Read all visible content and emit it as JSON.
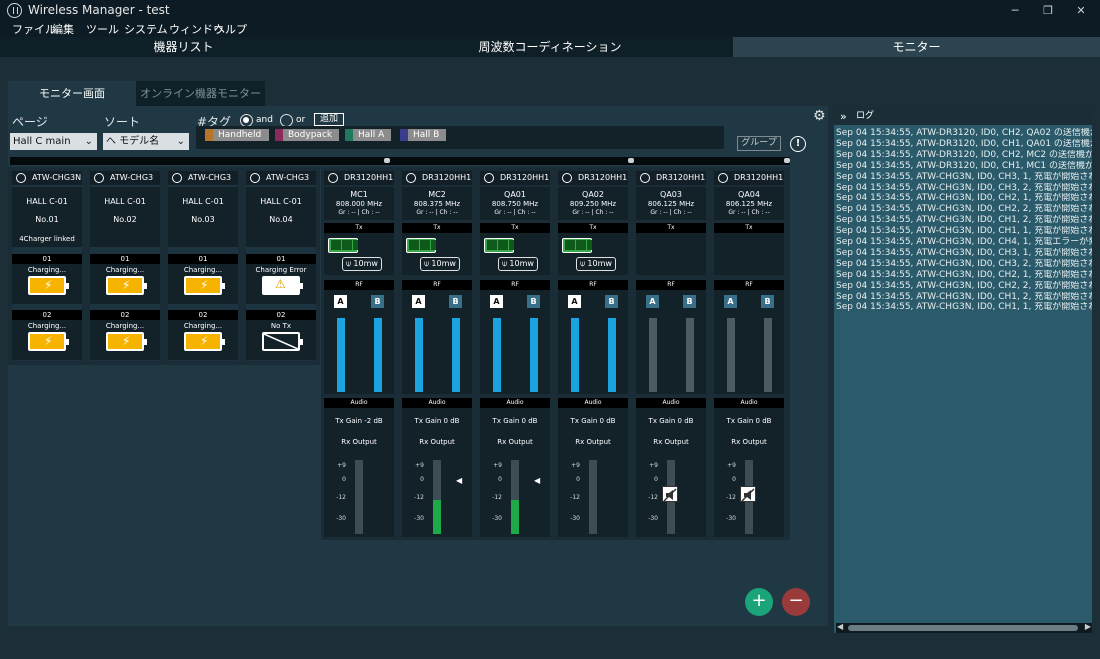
{
  "window": {
    "title": "Wireless Manager - test",
    "controls": [
      "─",
      "❐",
      "✕"
    ]
  },
  "menu": [
    "ファイル",
    "編集",
    "ツール",
    "システム",
    "ウィンドウ",
    "ヘルプ"
  ],
  "main_tabs": [
    {
      "label": "機器リスト"
    },
    {
      "label": "周波数コーディネーション"
    },
    {
      "label": "モニター"
    }
  ],
  "sub_tabs": [
    {
      "label": "モニター画面"
    },
    {
      "label": "オンライン機器モニター"
    }
  ],
  "filters": {
    "page_label": "ページ",
    "page_value": "Hall C main",
    "sort_label": "ソート",
    "sort_value": "へ モデル名",
    "tag_label": "#タグ",
    "and_label": "and",
    "or_label": "or",
    "add_label": "追加",
    "group_label": "グループ",
    "exclaim": "!"
  },
  "tags": [
    {
      "name": "Handheld",
      "color": "#b5752a"
    },
    {
      "name": "Bodypack",
      "color": "#8c2a5a"
    },
    {
      "name": "Hall A",
      "color": "#1e7a5a"
    },
    {
      "name": "Hall B",
      "color": "#3a3c8c"
    }
  ],
  "chargers": [
    {
      "model": "ATW-CHG3N",
      "room": "HALL C-01",
      "no": "No.01",
      "extra": "4Charger linked",
      "slots": [
        {
          "num": "01",
          "status": "Charging...",
          "state": "charging"
        },
        {
          "num": "02",
          "status": "Charging...",
          "state": "charging"
        }
      ]
    },
    {
      "model": "ATW-CHG3",
      "room": "HALL C-01",
      "no": "No.02",
      "extra": "",
      "slots": [
        {
          "num": "01",
          "status": "Charging...",
          "state": "charging"
        },
        {
          "num": "02",
          "status": "Charging...",
          "state": "charging"
        }
      ]
    },
    {
      "model": "ATW-CHG3",
      "room": "HALL C-01",
      "no": "No.03",
      "extra": "",
      "slots": [
        {
          "num": "01",
          "status": "Charging...",
          "state": "charging"
        },
        {
          "num": "02",
          "status": "Charging...",
          "state": "charging"
        }
      ]
    },
    {
      "model": "ATW-CHG3",
      "room": "HALL C-01",
      "no": "No.04",
      "extra": "",
      "slots": [
        {
          "num": "01",
          "status": "Charging Error",
          "state": "error"
        },
        {
          "num": "02",
          "status": "No Tx",
          "state": "none"
        }
      ]
    }
  ],
  "receivers": [
    {
      "model": "DR3120HH1",
      "name": "MC1",
      "freq": "808.000 MHz",
      "grch": "Gr : -- | Ch : --",
      "tx": true,
      "power": "10mw",
      "rf_active": true,
      "gain": "Tx Gain  -2  dB",
      "level": "none",
      "mute": false
    },
    {
      "model": "DR3120HH1",
      "name": "MC2",
      "freq": "808.375 MHz",
      "grch": "Gr : -- | Ch : --",
      "tx": true,
      "power": "10mw",
      "rf_active": true,
      "gain": "Tx Gain   0  dB",
      "level": "green",
      "mute": false
    },
    {
      "model": "DR3120HH1",
      "name": "QA01",
      "freq": "808.750 MHz",
      "grch": "Gr : -- | Ch : --",
      "tx": true,
      "power": "10mw",
      "rf_active": true,
      "gain": "Tx Gain   0  dB",
      "level": "green",
      "mute": false
    },
    {
      "model": "DR3120HH1",
      "name": "QA02",
      "freq": "809.250 MHz",
      "grch": "Gr : -- | Ch : --",
      "tx": true,
      "power": "10mw",
      "rf_active": true,
      "gain": "Tx Gain   0  dB",
      "level": "none",
      "mute": false
    },
    {
      "model": "DR3120HH1",
      "name": "QA03",
      "freq": "806.125 MHz",
      "grch": "Gr : -- | Ch : --",
      "tx": false,
      "power": "",
      "rf_active": false,
      "gain": "Tx Gain   0  dB",
      "level": "none",
      "mute": true
    },
    {
      "model": "DR3120HH1",
      "name": "QA04",
      "freq": "806.125 MHz",
      "grch": "Gr : -- | Ch : --",
      "tx": false,
      "power": "",
      "rf_active": false,
      "gain": "Tx Gain   0  dB",
      "level": "none",
      "mute": true
    }
  ],
  "labels": {
    "tx": "Tx",
    "rf": "RF",
    "a": "A",
    "b": "B",
    "audio": "Audio",
    "rx_output": "Rx Output",
    "scale": [
      "+9",
      "0",
      "-12",
      "-30"
    ]
  },
  "buttons": {
    "add": "+",
    "remove": "−"
  },
  "log": {
    "title": "ログ",
    "lines": [
      "Sep 04 15:34:55, ATW-DR3120, ID0, CH2, QA02 の送信機がミュー",
      "Sep 04 15:34:55, ATW-DR3120, ID0, CH1, QA01 の送信機がミュー",
      "Sep 04 15:34:55, ATW-DR3120, ID0, CH2, MC2 の送信機がミュー",
      "Sep 04 15:34:55, ATW-DR3120, ID0, CH1, MC1 の送信機がミュー",
      "Sep 04 15:34:55, ATW-CHG3N, ID0, CH3, 1,  充電が開始されまし",
      "Sep 04 15:34:55, ATW-CHG3N, ID0, CH3, 2,  充電が開始されまし",
      "Sep 04 15:34:55, ATW-CHG3N, ID0, CH2, 1,  充電が開始されまし",
      "Sep 04 15:34:55, ATW-CHG3N, ID0, CH2, 2,  充電が開始されまし",
      "Sep 04 15:34:55, ATW-CHG3N, ID0, CH1, 2,  充電が開始されまし",
      "Sep 04 15:34:55, ATW-CHG3N, ID0, CH1, 1,  充電が開始されまし",
      "Sep 04 15:34:55, ATW-CHG3N, ID0, CH4, 1,  充電エラーが発生し",
      "Sep 04 15:34:55, ATW-CHG3N, ID0, CH3, 1,  充電が開始されまし",
      "Sep 04 15:34:55, ATW-CHG3N, ID0, CH3, 2,  充電が開始されまし",
      "Sep 04 15:34:55, ATW-CHG3N, ID0, CH2, 1,  充電が開始されまし",
      "Sep 04 15:34:55, ATW-CHG3N, ID0, CH2, 2,  充電が開始されまし",
      "Sep 04 15:34:55, ATW-CHG3N, ID0, CH1, 2,  充電が開始されまし",
      "Sep 04 15:34:55, ATW-CHG3N, ID0, CH1, 1,  充電が開始されまし"
    ]
  },
  "colors": {
    "accent_green": "#1ba37a",
    "remove_red": "#9a3b3b",
    "meter_blue": "#1ba3e0",
    "battery_yellow": "#f6b400"
  }
}
